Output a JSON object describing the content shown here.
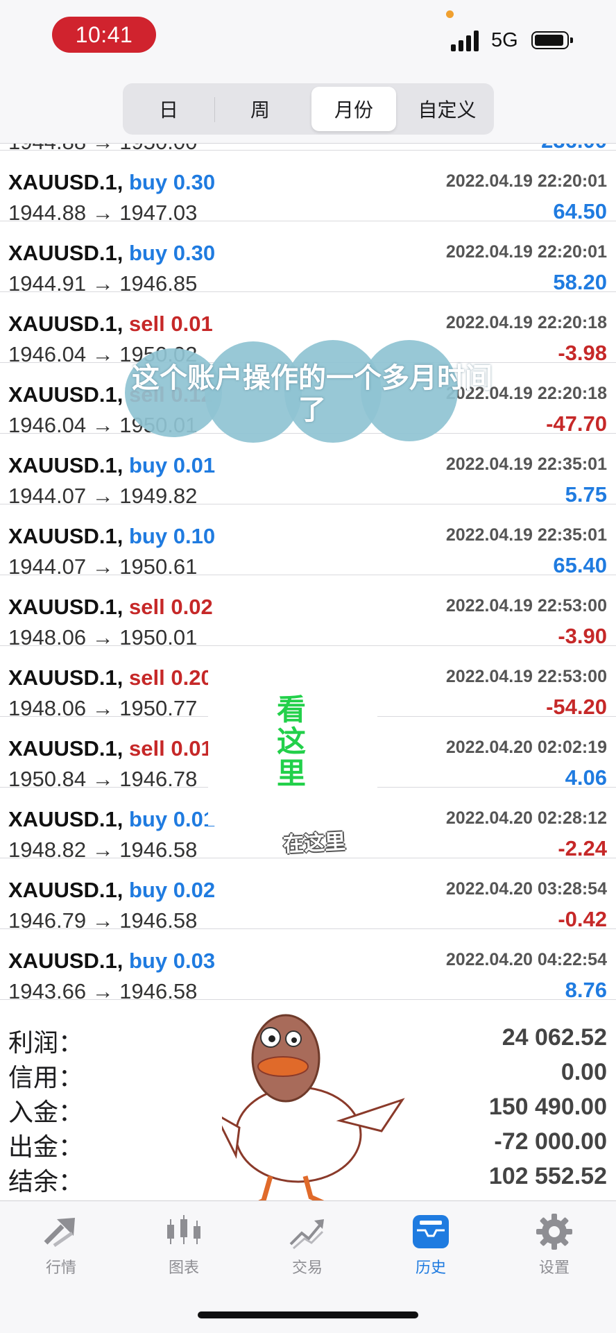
{
  "status_bar": {
    "time": "10:41",
    "network": "5G"
  },
  "segment": {
    "items": [
      {
        "label": "日",
        "active": false
      },
      {
        "label": "周",
        "active": false
      },
      {
        "label": "月份",
        "active": true
      },
      {
        "label": "自定义",
        "active": false
      }
    ]
  },
  "partial_row": {
    "prices": "1944.88 → 1950.00",
    "profit": "236.00"
  },
  "trades": [
    {
      "symbol": "XAUUSD.1,",
      "direction": "buy",
      "volume": "0.30",
      "datetime": "2022.04.19 22:20:01",
      "prices": "1944.88 → 1947.03",
      "profit": "64.50"
    },
    {
      "symbol": "XAUUSD.1,",
      "direction": "buy",
      "volume": "0.30",
      "datetime": "2022.04.19 22:20:01",
      "prices": "1944.91 → 1946.85",
      "profit": "58.20"
    },
    {
      "symbol": "XAUUSD.1,",
      "direction": "sell",
      "volume": "0.01",
      "datetime": "2022.04.19 22:20:18",
      "prices": "1946.04 → 1950.02",
      "profit": "-3.98"
    },
    {
      "symbol": "XAUUSD.1,",
      "direction": "sell",
      "volume": "0.12",
      "datetime": "2022.04.19 22:20:18",
      "prices": "1946.04 → 1950.01",
      "profit": "-47.70"
    },
    {
      "symbol": "XAUUSD.1,",
      "direction": "buy",
      "volume": "0.01",
      "datetime": "2022.04.19 22:35:01",
      "prices": "1944.07 → 1949.82",
      "profit": "5.75"
    },
    {
      "symbol": "XAUUSD.1,",
      "direction": "buy",
      "volume": "0.10",
      "datetime": "2022.04.19 22:35:01",
      "prices": "1944.07 → 1950.61",
      "profit": "65.40"
    },
    {
      "symbol": "XAUUSD.1,",
      "direction": "sell",
      "volume": "0.02",
      "datetime": "2022.04.19 22:53:00",
      "prices": "1948.06 → 1950.01",
      "profit": "-3.90"
    },
    {
      "symbol": "XAUUSD.1,",
      "direction": "sell",
      "volume": "0.20",
      "datetime": "2022.04.19 22:53:00",
      "prices": "1948.06 → 1950.77",
      "profit": "-54.20"
    },
    {
      "symbol": "XAUUSD.1,",
      "direction": "sell",
      "volume": "0.01",
      "datetime": "2022.04.20 02:02:19",
      "prices": "1950.84 → 1946.78",
      "profit": "4.06"
    },
    {
      "symbol": "XAUUSD.1,",
      "direction": "buy",
      "volume": "0.01",
      "datetime": "2022.04.20 02:28:12",
      "prices": "1948.82 → 1946.58",
      "profit": "-2.24"
    },
    {
      "symbol": "XAUUSD.1,",
      "direction": "buy",
      "volume": "0.02",
      "datetime": "2022.04.20 03:28:54",
      "prices": "1946.79 → 1946.58",
      "profit": "-0.42"
    },
    {
      "symbol": "XAUUSD.1,",
      "direction": "buy",
      "volume": "0.03",
      "datetime": "2022.04.20 04:22:54",
      "prices": "1943.66 → 1946.58",
      "profit": "8.76"
    }
  ],
  "summary": [
    {
      "label": "利润：",
      "value": "24 062.52"
    },
    {
      "label": "信用：",
      "value": "0.00"
    },
    {
      "label": "入金：",
      "value": "150 490.00"
    },
    {
      "label": "出金：",
      "value": "-72 000.00"
    },
    {
      "label": "结余：",
      "value": "102 552.52"
    }
  ],
  "tabbar": {
    "items": [
      {
        "label": "行情",
        "icon": "quotes-arrows-icon",
        "active": false
      },
      {
        "label": "图表",
        "icon": "candlestick-chart-icon",
        "active": false
      },
      {
        "label": "交易",
        "icon": "trade-line-icon",
        "active": false
      },
      {
        "label": "历史",
        "icon": "history-inbox-icon",
        "active": true
      },
      {
        "label": "设置",
        "icon": "gear-icon",
        "active": false
      }
    ]
  },
  "overlay": {
    "caption": "这个账户操作的一个多月时间了",
    "look_text": "看这里",
    "look_sub": "在这里"
  },
  "colors": {
    "buy": "#1f7be0",
    "sell": "#c62828",
    "active_tab": "#1f7be0",
    "time_pill": "#d0232e",
    "look_text": "#22d04a"
  }
}
